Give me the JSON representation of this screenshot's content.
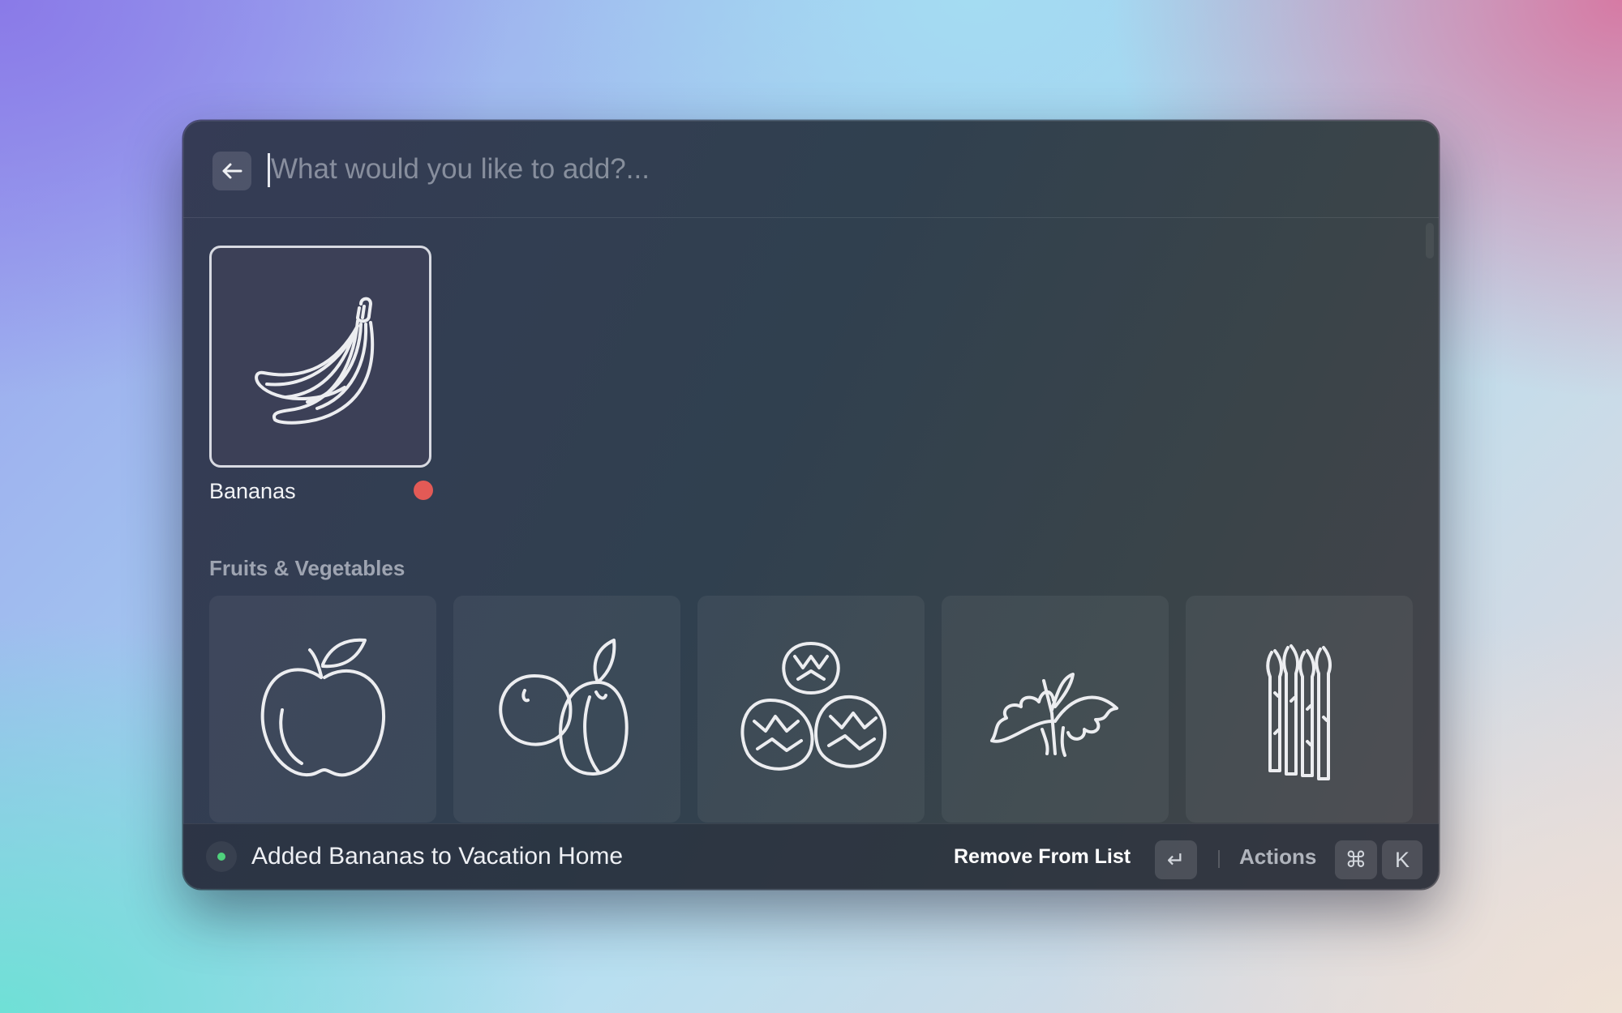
{
  "search": {
    "placeholder": "What would you like to add?...",
    "back_icon": "arrow-left-icon"
  },
  "selected_item": {
    "label": "Bananas",
    "icon": "banana-icon",
    "status_color": "#e35a56"
  },
  "section": {
    "title": "Fruits & Vegetables",
    "items": [
      {
        "icon": "apple-icon"
      },
      {
        "icon": "plums-icon"
      },
      {
        "icon": "artichokes-icon"
      },
      {
        "icon": "arugula-icon"
      },
      {
        "icon": "asparagus-icon"
      }
    ]
  },
  "footer": {
    "toast": "Added Bananas to Vacation Home",
    "toast_status_color": "#4fd17c",
    "primary_action": "Remove From List",
    "primary_key": "↵",
    "actions_label": "Actions",
    "actions_keys": [
      "⌘",
      "K"
    ]
  }
}
